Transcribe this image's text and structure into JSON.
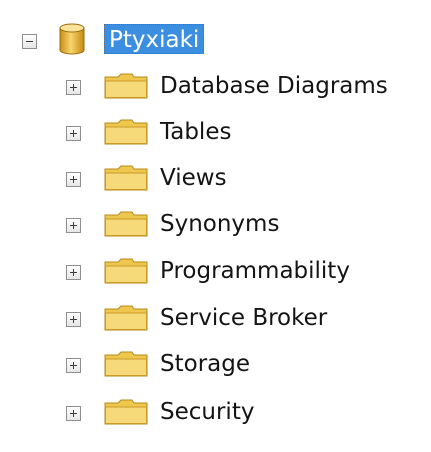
{
  "tree": {
    "root": {
      "label": "Ptyxiaki",
      "icon": "database-icon",
      "expanded": true,
      "selected": true
    },
    "children": [
      {
        "label": "Database Diagrams",
        "icon": "folder-icon"
      },
      {
        "label": "Tables",
        "icon": "folder-icon"
      },
      {
        "label": "Views",
        "icon": "folder-icon"
      },
      {
        "label": "Synonyms",
        "icon": "folder-icon"
      },
      {
        "label": "Programmability",
        "icon": "folder-icon"
      },
      {
        "label": "Service Broker",
        "icon": "folder-icon"
      },
      {
        "label": "Storage",
        "icon": "folder-icon"
      },
      {
        "label": "Security",
        "icon": "folder-icon"
      }
    ]
  },
  "colors": {
    "selection_background": "#3c8fe0",
    "selection_text": "#ffffff",
    "text": "#141414",
    "folder_fill": "#f2cf5c",
    "database_fill": "#e8b83a"
  }
}
